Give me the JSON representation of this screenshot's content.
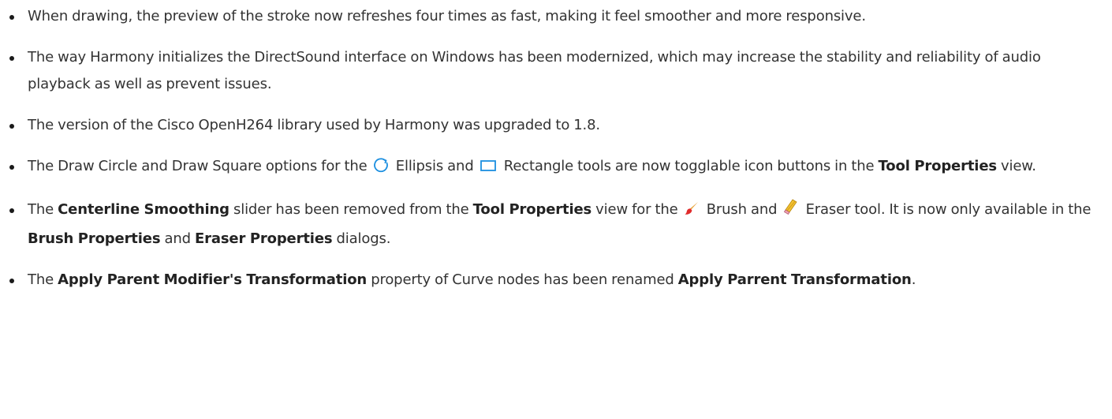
{
  "notes": [
    {
      "text": "When drawing, the preview of the stroke now refreshes four times as fast, making it feel smoother and more responsive."
    },
    {
      "text": "The way Harmony initializes the DirectSound interface on Windows has been modernized, which may increase the stability and reliability of audio playback as well as prevent issues."
    },
    {
      "text": "The version of the Cisco OpenH264 library used by Harmony was upgraded to 1.8."
    },
    {
      "p1": "The Draw Circle and Draw Square options for the",
      "ellipsis_label": "Ellipsis and",
      "rectangle_label": "Rectangle tools are now togglable icon buttons in the",
      "tool_properties": "Tool Properties",
      "p2": "view.",
      "ellipsis_icon": "ellipse-tool-icon",
      "rectangle_icon": "rectangle-tool-icon",
      "icon_color": "#1c8fe0"
    },
    {
      "p1": "The",
      "centerline_smoothing": "Centerline Smoothing",
      "p2": "slider has been removed from the",
      "tool_properties": "Tool Properties",
      "p3": "view for the",
      "brush_label": "Brush and",
      "eraser_label": "Eraser tool. It is now only available in the",
      "brush_properties": "Brush Properties",
      "and": "and",
      "eraser_properties": "Eraser Properties",
      "p4": "dialogs.",
      "brush_icon": "brush-tool-icon",
      "eraser_icon": "eraser-tool-icon"
    },
    {
      "p1": "The",
      "apply_parent_modifier": "Apply Parent Modifier's Transformation",
      "p2": "property of Curve nodes has been renamed",
      "apply_parrent": "Apply Parrent Transformation",
      "p3": "."
    }
  ]
}
